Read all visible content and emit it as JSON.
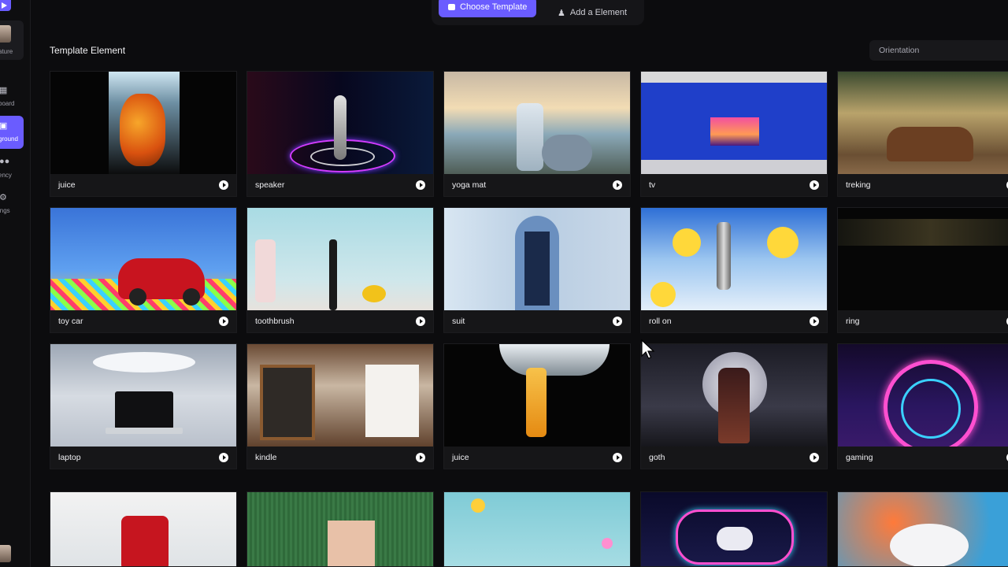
{
  "sidebar": {
    "items": [
      {
        "label": "ature",
        "icon": "avatar"
      },
      {
        "label": "board",
        "icon": "grid-icon"
      },
      {
        "label": "ground",
        "icon": "image-icon",
        "active": true
      },
      {
        "label": "ency",
        "icon": "people-icon"
      },
      {
        "label": "ings",
        "icon": "gear-icon"
      }
    ]
  },
  "top": {
    "primary_label": "Choose Template",
    "secondary_label": "Add a Element"
  },
  "section_title": "Template Element",
  "orientation_placeholder": "Orientation",
  "cards": [
    {
      "label": "juice"
    },
    {
      "label": "speaker"
    },
    {
      "label": "yoga mat"
    },
    {
      "label": "tv"
    },
    {
      "label": "treking"
    },
    {
      "label": "toy car"
    },
    {
      "label": "toothbrush"
    },
    {
      "label": "suit"
    },
    {
      "label": "roll on"
    },
    {
      "label": "ring"
    },
    {
      "label": "laptop"
    },
    {
      "label": "kindle"
    },
    {
      "label": "juice"
    },
    {
      "label": "goth"
    },
    {
      "label": "gaming"
    },
    {
      "label": ""
    },
    {
      "label": ""
    },
    {
      "label": ""
    },
    {
      "label": ""
    },
    {
      "label": ""
    }
  ],
  "colors": {
    "accent": "#6a5cff",
    "background": "#0c0c0e",
    "card": "#161618"
  }
}
